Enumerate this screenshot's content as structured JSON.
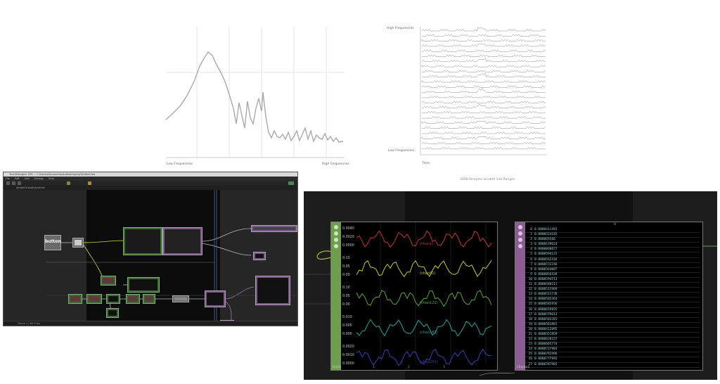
{
  "spectrum_chart": {
    "xlabel_left": "Low Frequencies",
    "xlabel_right": "High Frequencies"
  },
  "bins_chart": {
    "ylabel_top": "High Frequencies",
    "ylabel_bottom": "Low Frequencies",
    "xlabel": "Time",
    "caption": "2048 Samples located into Ranges"
  },
  "editor": {
    "title": "TouchDesigner 099 — C:/Users/Documents/AudioAnalysis/Untitled.toe",
    "menu": [
      "File",
      "Edit",
      "Add",
      "Dialogs",
      "Help"
    ],
    "path": "/project1/audioAnalysis",
    "button_node": "button",
    "status": "Frame 1  |  60.0 fps"
  },
  "chop_viewer": {
    "panel_name": "trail1",
    "channels": [
      {
        "name": "chan1",
        "scale": [
          "0.0040",
          "0.0020",
          "0.0000"
        ],
        "color": "#c0392b"
      },
      {
        "name": "chan61",
        "scale": [
          "0.10",
          "0.05",
          "0.00"
        ],
        "color": "#c8c83a"
      },
      {
        "name": "chan121",
        "scale": [
          "0.10",
          "0.05",
          "0.00"
        ],
        "color": "#57a63a"
      },
      {
        "name": "chan181",
        "scale": [
          "0.010",
          "0.005",
          "0.000"
        ],
        "color": "#2aa19c"
      },
      {
        "name": "chan241",
        "scale": [
          "0.0020",
          "0.0010",
          "0.0000"
        ],
        "color": "#3a3fb0"
      }
    ],
    "time_ticks": [
      "1",
      "2",
      "3"
    ]
  },
  "table_viewer": {
    "panel_name": "chopto1",
    "header": "0",
    "rows": [
      "0.0000411403",
      "0.0000524183",
      "0.000001586",
      "0.0000139624",
      "0.0000060077",
      "0.0000594131",
      "0.0000562416",
      "0.0000572246",
      "0.0000564007",
      "0.0000056428",
      "0.0000594213",
      "0.0000588211",
      "0.0000515969",
      "0.0000511738",
      "0.0000505364",
      "0.0000585956",
      "0.0000659855",
      "0.0000579613",
      "0.0000502281",
      "0.0000561861",
      "0.0000412895",
      "0.0000551859",
      "0.0000620157",
      "0.0000605774",
      "0.0000737903",
      "0.0000792496",
      "0.0000777993",
      "0.0000787902"
    ]
  },
  "colors": {
    "chop_bar": "#6f9d4d",
    "table_bar": "#8c5d93",
    "editor_bg": "#1b1b1b"
  }
}
